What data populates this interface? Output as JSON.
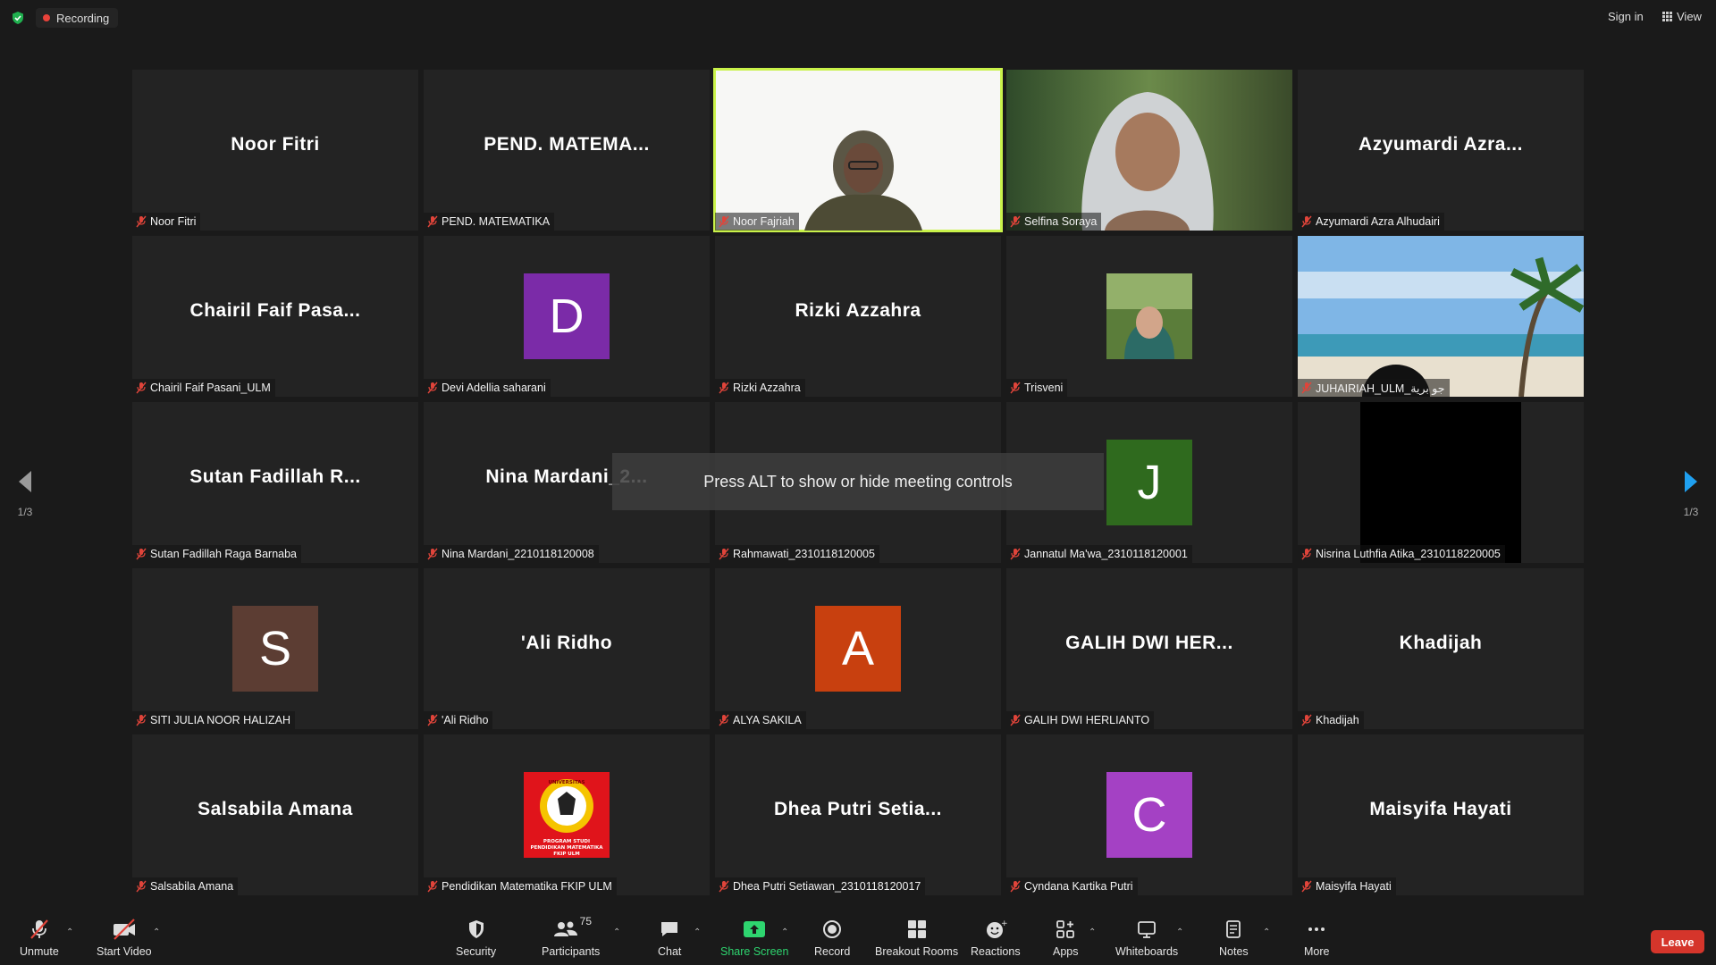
{
  "topbar": {
    "recording_label": "Recording",
    "sign_in": "Sign in",
    "view": "View"
  },
  "alt_tip": "Press ALT to show or hide meeting controls",
  "nav": {
    "left_page": "1/3",
    "right_page": "1/3"
  },
  "tiles": [
    {
      "name": "Noor Fitri",
      "center": "Noor Fitri"
    },
    {
      "name": "PEND. MATEMATIKA",
      "center": "PEND.  MATEMA..."
    },
    {
      "name": "Noor Fajriah",
      "video": true
    },
    {
      "name": "Selfina Soraya",
      "video": true
    },
    {
      "name": "Azyumardi Azra Alhudairi",
      "center": "Azyumardi  Azra..."
    },
    {
      "name": "Chairil Faif Pasani_ULM",
      "center": "Chairil  Faif  Pasa..."
    },
    {
      "name": "Devi Adellia saharani",
      "avatar_letter": "D"
    },
    {
      "name": "Rizki Azzahra",
      "center": "Rizki  Azzahra"
    },
    {
      "name": "Trisveni",
      "photo": true
    },
    {
      "name": "JUHAIRIAH_ULM_جو برية",
      "video": true
    },
    {
      "name": "Sutan Fadillah Raga Barnaba",
      "center": "Sutan  Fadillah  R..."
    },
    {
      "name": "Nina Mardani_2210118120008",
      "center": "Nina  Mardani_2..."
    },
    {
      "name": "Rahmawati_2310118120005",
      "center": ""
    },
    {
      "name": "Jannatul Ma'wa_2310118120001",
      "avatar_letter": "J"
    },
    {
      "name": "Nisrina Luthfia Atika_2310118220005",
      "black": true
    },
    {
      "name": "SITI JULIA NOOR HALIZAH",
      "avatar_letter": "S"
    },
    {
      "name": "'Ali Ridho",
      "center": "'Ali Ridho"
    },
    {
      "name": "ALYA SAKILA",
      "avatar_letter": "A"
    },
    {
      "name": "GALIH DWI HERLIANTO",
      "center": "GALIH  DWI  HER..."
    },
    {
      "name": "Khadijah",
      "center": "Khadijah"
    },
    {
      "name": "Salsabila Amana",
      "center": "Salsabila Amana"
    },
    {
      "name": "Pendidikan Matematika FKIP ULM",
      "logo": true
    },
    {
      "name": "Dhea Putri Setiawan_2310118120017",
      "center": "Dhea  Putri  Setia..."
    },
    {
      "name": "Cyndana Kartika Putri",
      "avatar_letter": "C"
    },
    {
      "name": "Maisyifa Hayati",
      "center": "Maisyifa  Hayati"
    }
  ],
  "avatar_colors": {
    "D": "#7b2ba8",
    "J": "#2f6a1e",
    "S": "#5c3d33",
    "A": "#c8400f",
    "C": "#a441c4"
  },
  "logo_text": {
    "top": "UNIVERSITAS",
    "line1": "PROGRAM STUDI",
    "line2": "PENDIDIKAN MATEMATIKA",
    "line3": "FKIP ULM"
  },
  "toolbar": {
    "unmute": "Unmute",
    "start_video": "Start Video",
    "security": "Security",
    "participants": "Participants",
    "participant_count": "75",
    "chat": "Chat",
    "share_screen": "Share Screen",
    "record": "Record",
    "breakout_rooms": "Breakout Rooms",
    "reactions": "Reactions",
    "apps": "Apps",
    "whiteboards": "Whiteboards",
    "notes": "Notes",
    "more": "More",
    "leave": "Leave"
  }
}
